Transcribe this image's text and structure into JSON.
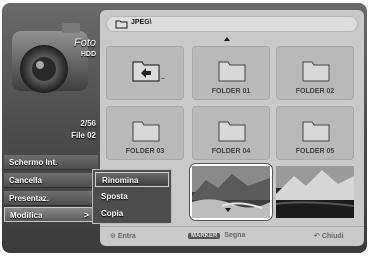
{
  "header": {
    "mode_label": "Foto",
    "source_label": "HDD",
    "path": "JPEG\\"
  },
  "info": {
    "counter": "2/56",
    "file_name": "File 02"
  },
  "left_menu": [
    {
      "label": "Schermo Int."
    },
    {
      "label": "Cancella"
    },
    {
      "label": "Presentaz."
    },
    {
      "label": "Modifica",
      "arrow": ">"
    }
  ],
  "submenu": [
    {
      "label": "Rinomina",
      "selected": true
    },
    {
      "label": "Sposta",
      "selected": false
    },
    {
      "label": "Copia",
      "selected": false
    }
  ],
  "grid": {
    "parent_tile": {
      "label": ".."
    },
    "folders": [
      "FOLDER 01",
      "FOLDER 02",
      "FOLDER 03",
      "FOLDER 04",
      "FOLDER 05"
    ]
  },
  "bottom": {
    "enter_label": "Entra",
    "marker_key": "MARKER",
    "marker_label": "Segna",
    "close_label": "Chiudi"
  },
  "colors": {
    "panel_bg": "#c9c9c9",
    "frame_dark": "#4c4c4c",
    "text_light": "#ffffff"
  }
}
